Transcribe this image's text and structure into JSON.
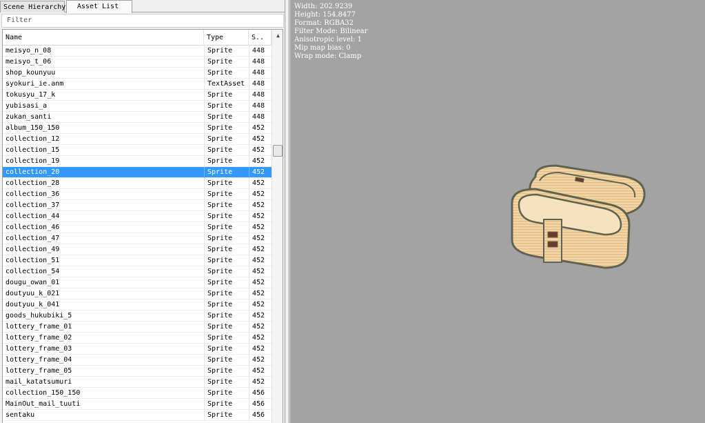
{
  "tabs": {
    "scene_hierarchy": "Scene Hierarchy",
    "asset_list": "Asset List"
  },
  "filter": {
    "label": "Filter"
  },
  "columns": {
    "name": "Name",
    "type": "Type",
    "size": "S.."
  },
  "rows": [
    {
      "name": "meisyo_n_08",
      "type": "Sprite",
      "size": "448"
    },
    {
      "name": "meisyo_t_06",
      "type": "Sprite",
      "size": "448"
    },
    {
      "name": "shop_kounyuu",
      "type": "Sprite",
      "size": "448"
    },
    {
      "name": "syokuri_ie.anm",
      "type": "TextAsset",
      "size": "448"
    },
    {
      "name": "tokusyu_17_k",
      "type": "Sprite",
      "size": "448"
    },
    {
      "name": "yubisasi_a",
      "type": "Sprite",
      "size": "448"
    },
    {
      "name": "zukan_santi",
      "type": "Sprite",
      "size": "448"
    },
    {
      "name": "album_150_150",
      "type": "Sprite",
      "size": "452"
    },
    {
      "name": "collection_12",
      "type": "Sprite",
      "size": "452"
    },
    {
      "name": "collection_15",
      "type": "Sprite",
      "size": "452"
    },
    {
      "name": "collection_19",
      "type": "Sprite",
      "size": "452"
    },
    {
      "name": "collection_20",
      "type": "Sprite",
      "size": "452",
      "selected": true
    },
    {
      "name": "collection_28",
      "type": "Sprite",
      "size": "452"
    },
    {
      "name": "collection_36",
      "type": "Sprite",
      "size": "452"
    },
    {
      "name": "collection_37",
      "type": "Sprite",
      "size": "452"
    },
    {
      "name": "collection_44",
      "type": "Sprite",
      "size": "452"
    },
    {
      "name": "collection_46",
      "type": "Sprite",
      "size": "452"
    },
    {
      "name": "collection_47",
      "type": "Sprite",
      "size": "452"
    },
    {
      "name": "collection_49",
      "type": "Sprite",
      "size": "452"
    },
    {
      "name": "collection_51",
      "type": "Sprite",
      "size": "452"
    },
    {
      "name": "collection_54",
      "type": "Sprite",
      "size": "452"
    },
    {
      "name": "dougu_owan_01",
      "type": "Sprite",
      "size": "452"
    },
    {
      "name": "doutyuu_k_021",
      "type": "Sprite",
      "size": "452"
    },
    {
      "name": "doutyuu_k_041",
      "type": "Sprite",
      "size": "452"
    },
    {
      "name": "goods_hukubiki_5",
      "type": "Sprite",
      "size": "452"
    },
    {
      "name": "lottery_frame_01",
      "type": "Sprite",
      "size": "452"
    },
    {
      "name": "lottery_frame_02",
      "type": "Sprite",
      "size": "452"
    },
    {
      "name": "lottery_frame_03",
      "type": "Sprite",
      "size": "452"
    },
    {
      "name": "lottery_frame_04",
      "type": "Sprite",
      "size": "452"
    },
    {
      "name": "lottery_frame_05",
      "type": "Sprite",
      "size": "452"
    },
    {
      "name": "mail_katatsumuri",
      "type": "Sprite",
      "size": "452"
    },
    {
      "name": "collection_150_150",
      "type": "Sprite",
      "size": "456"
    },
    {
      "name": "MainOut_mail_tuuti",
      "type": "Sprite",
      "size": "456"
    },
    {
      "name": "sentaku",
      "type": "Sprite",
      "size": "456"
    }
  ],
  "scrollbar": {
    "up_icon": "arrow-up-icon"
  },
  "preview": {
    "width": "Width: 202.9239",
    "height": "Height: 154.8477",
    "format": "Format: RGBA32",
    "filter_mode": "Filter Mode: Bilinear",
    "aniso": "Anisotropic level: 1",
    "mipmap": "Mip map bias: 0",
    "wrap": "Wrap mode: Clamp"
  },
  "colors": {
    "selection": "#3399ff",
    "preview_bg": "#a3a3a3",
    "wood": "#f1d5a6",
    "outline": "#5f6350"
  }
}
